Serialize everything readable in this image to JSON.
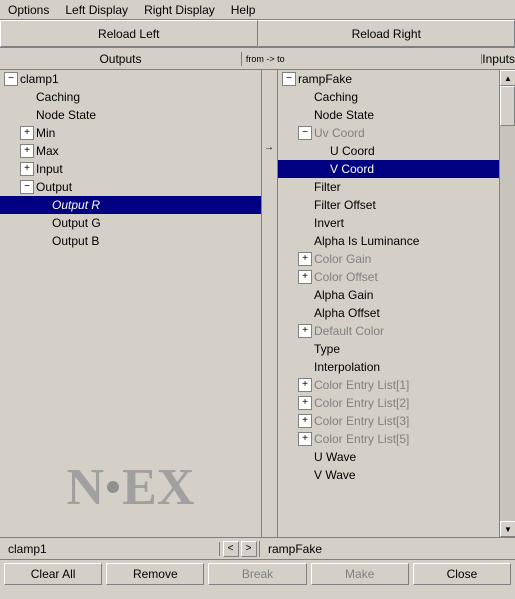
{
  "menubar": {
    "items": [
      "Options",
      "Left Display",
      "Right Display",
      "Help"
    ]
  },
  "reload": {
    "left_label": "Reload Left",
    "right_label": "Reload Right"
  },
  "headers": {
    "outputs": "Outputs",
    "from_to": "from -> to",
    "inputs": "Inputs"
  },
  "left_panel": {
    "node": "clamp1",
    "items": [
      {
        "label": "clamp1",
        "expand": "minus",
        "indent": 0,
        "grayed": false
      },
      {
        "label": "Caching",
        "expand": "none",
        "indent": 1,
        "grayed": false
      },
      {
        "label": "Node State",
        "expand": "none",
        "indent": 1,
        "grayed": false
      },
      {
        "label": "Min",
        "expand": "plus",
        "indent": 1,
        "grayed": false
      },
      {
        "label": "Max",
        "expand": "plus",
        "indent": 1,
        "grayed": false
      },
      {
        "label": "Input",
        "expand": "plus",
        "indent": 1,
        "grayed": false
      },
      {
        "label": "Output",
        "expand": "minus",
        "indent": 1,
        "grayed": false
      },
      {
        "label": "Output R",
        "expand": "none",
        "indent": 2,
        "selected": true,
        "italic": true,
        "grayed": false
      },
      {
        "label": "Output G",
        "expand": "none",
        "indent": 2,
        "grayed": false
      },
      {
        "label": "Output B",
        "expand": "none",
        "indent": 2,
        "grayed": false
      }
    ]
  },
  "right_panel": {
    "node": "rampFake",
    "items": [
      {
        "label": "rampFake",
        "expand": "minus",
        "indent": 0,
        "grayed": false
      },
      {
        "label": "Caching",
        "expand": "none",
        "indent": 1,
        "grayed": false
      },
      {
        "label": "Node State",
        "expand": "none",
        "indent": 1,
        "grayed": false
      },
      {
        "label": "Uv Coord",
        "expand": "minus",
        "indent": 1,
        "grayed": true,
        "has_arrow": true
      },
      {
        "label": "U Coord",
        "expand": "none",
        "indent": 2,
        "grayed": false
      },
      {
        "label": "V Coord",
        "expand": "none",
        "indent": 2,
        "grayed": false,
        "selected": true
      },
      {
        "label": "Filter",
        "expand": "none",
        "indent": 1,
        "grayed": false
      },
      {
        "label": "Filter Offset",
        "expand": "none",
        "indent": 1,
        "grayed": false
      },
      {
        "label": "Invert",
        "expand": "none",
        "indent": 1,
        "grayed": false
      },
      {
        "label": "Alpha Is Luminance",
        "expand": "none",
        "indent": 1,
        "grayed": false
      },
      {
        "label": "Color Gain",
        "expand": "plus",
        "indent": 1,
        "grayed": true
      },
      {
        "label": "Color Offset",
        "expand": "plus",
        "indent": 1,
        "grayed": true
      },
      {
        "label": "Alpha Gain",
        "expand": "none",
        "indent": 1,
        "grayed": false
      },
      {
        "label": "Alpha Offset",
        "expand": "none",
        "indent": 1,
        "grayed": false
      },
      {
        "label": "Default Color",
        "expand": "plus",
        "indent": 1,
        "grayed": true
      },
      {
        "label": "Type",
        "expand": "none",
        "indent": 1,
        "grayed": false
      },
      {
        "label": "Interpolation",
        "expand": "none",
        "indent": 1,
        "grayed": false
      },
      {
        "label": "Color Entry List[1]",
        "expand": "plus",
        "indent": 1,
        "grayed": true
      },
      {
        "label": "Color Entry List[2]",
        "expand": "plus",
        "indent": 1,
        "grayed": true
      },
      {
        "label": "Color Entry List[3]",
        "expand": "plus",
        "indent": 1,
        "grayed": true
      },
      {
        "label": "Color Entry List[5]",
        "expand": "plus",
        "indent": 1,
        "grayed": true
      },
      {
        "label": "U Wave",
        "expand": "none",
        "indent": 1,
        "grayed": false
      },
      {
        "label": "V Wave",
        "expand": "none",
        "indent": 1,
        "grayed": false
      }
    ]
  },
  "status": {
    "left": "clamp1",
    "right": "rampFake"
  },
  "buttons": {
    "clear_all": "Clear All",
    "remove": "Remove",
    "break": "Break",
    "make": "Make",
    "close": "Close"
  },
  "logo": {
    "text_n": "N",
    "text_o": "o",
    "text_ex": "EX"
  }
}
